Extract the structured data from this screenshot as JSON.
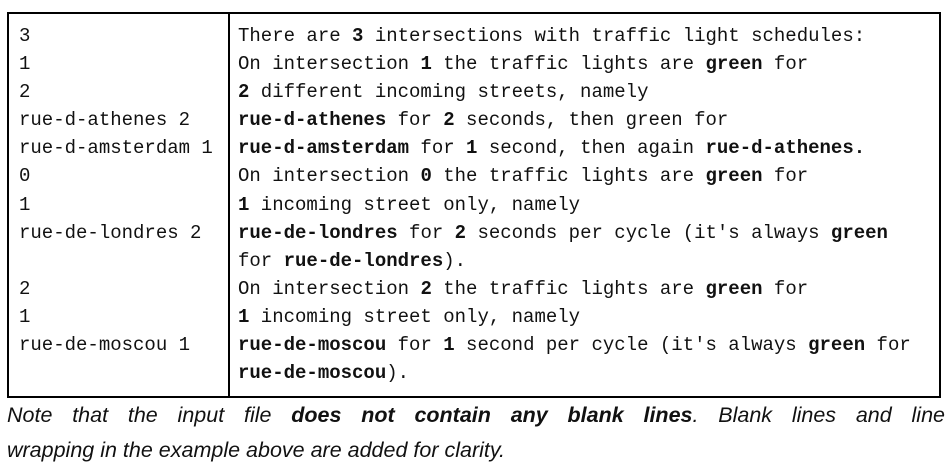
{
  "input_lines": [
    "3",
    "1",
    "2",
    "rue-d-athenes 2",
    "rue-d-amsterdam 1",
    "0",
    "1",
    "rue-de-londres 2",
    "",
    "2",
    "1",
    "rue-de-moscou 1",
    ""
  ],
  "explanation_lines": [
    [
      [
        "There are ",
        false
      ],
      [
        "3",
        true
      ],
      [
        " intersections with traffic light schedules:",
        false
      ]
    ],
    [
      [
        "On intersection ",
        false
      ],
      [
        "1",
        true
      ],
      [
        " the traffic lights are ",
        false
      ],
      [
        "green",
        true
      ],
      [
        " for",
        false
      ]
    ],
    [
      [
        "2",
        true
      ],
      [
        " different incoming streets, namely",
        false
      ]
    ],
    [
      [
        "rue-d-athenes",
        true
      ],
      [
        " for ",
        false
      ],
      [
        "2",
        true
      ],
      [
        " seconds, then green for",
        false
      ]
    ],
    [
      [
        "rue-d-amsterdam",
        true
      ],
      [
        " for ",
        false
      ],
      [
        "1",
        true
      ],
      [
        " second, then again ",
        false
      ],
      [
        "rue-d-athenes.",
        true
      ]
    ],
    [
      [
        "On intersection ",
        false
      ],
      [
        "0",
        true
      ],
      [
        " the traffic lights are ",
        false
      ],
      [
        "green",
        true
      ],
      [
        " for",
        false
      ]
    ],
    [
      [
        "1",
        true
      ],
      [
        " incoming street only, namely",
        false
      ]
    ],
    [
      [
        "rue-de-londres",
        true
      ],
      [
        " for ",
        false
      ],
      [
        "2",
        true
      ],
      [
        " seconds per cycle (it's always ",
        false
      ],
      [
        "green",
        true
      ]
    ],
    [
      [
        "for ",
        false
      ],
      [
        "rue-de-londres",
        true
      ],
      [
        ").",
        false
      ]
    ],
    [
      [
        "On intersection ",
        false
      ],
      [
        "2",
        true
      ],
      [
        " the traffic lights are ",
        false
      ],
      [
        "green",
        true
      ],
      [
        " for",
        false
      ]
    ],
    [
      [
        "1",
        true
      ],
      [
        " incoming street only, namely",
        false
      ]
    ],
    [
      [
        "rue-de-moscou",
        true
      ],
      [
        " for ",
        false
      ],
      [
        "1",
        true
      ],
      [
        " second per cycle (it's always ",
        false
      ],
      [
        "green",
        true
      ],
      [
        " for",
        false
      ]
    ],
    [
      [
        "rue-de-moscou",
        true
      ],
      [
        ").",
        false
      ]
    ]
  ],
  "note": {
    "part1": "Note that the input file ",
    "bold": "does not contain any blank lines",
    "part2": ". Blank lines and line",
    "line2": "wrapping in the example above are added for clarity."
  }
}
